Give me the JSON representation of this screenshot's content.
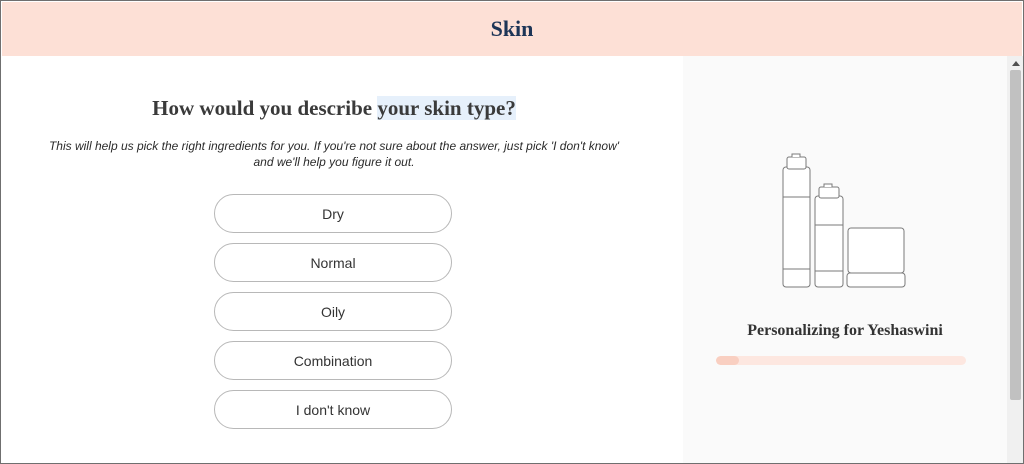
{
  "header": {
    "title": "Skin"
  },
  "question": {
    "title_start": "How would you describe ",
    "title_highlight": "your skin type?",
    "hint": "This will help us pick the right ingredients for you. If you're not sure about the answer, just pick 'I don't know' and we'll help you figure it out."
  },
  "options": [
    "Dry",
    "Normal",
    "Oily",
    "Combination",
    "I don't know"
  ],
  "side": {
    "personalizing_text": "Personalizing for Yeshaswini",
    "progress": 0.09
  },
  "colors": {
    "header_bg": "#fde0d6",
    "header_title": "#1d3557",
    "progress_track": "#fde7e0",
    "progress_fill": "#f9cfc1"
  }
}
